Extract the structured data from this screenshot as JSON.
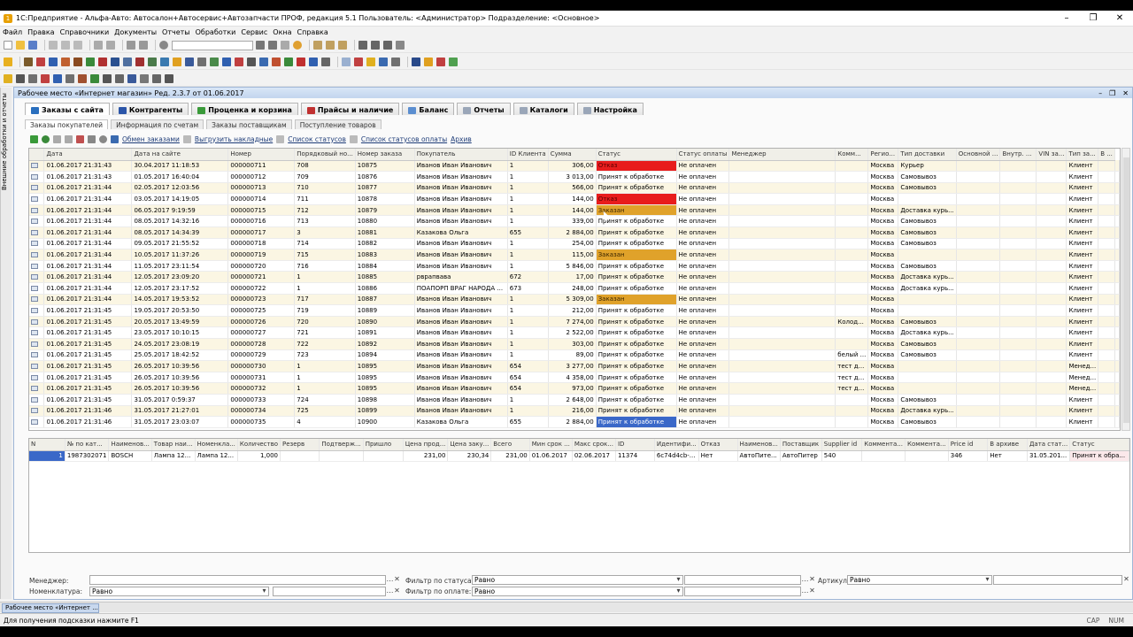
{
  "window": {
    "title": "1С:Предприятие - Альфа-Авто: Автосалон+Автосервис+Автозапчасти ПРОФ, редакция 5.1    Пользователь: <Администратор>    Подразделение: <Основное>"
  },
  "menu": [
    "Файл",
    "Правка",
    "Справочники",
    "Документы",
    "Отчеты",
    "Обработки",
    "Сервис",
    "Окна",
    "Справка"
  ],
  "leftpanel": {
    "label": "Внешние обработки и отчеты"
  },
  "workspace": {
    "title": "Рабочее место «Интернет магазин» Ред. 2.3.7 от 01.06.2017"
  },
  "main_tabs": [
    {
      "label": "Заказы с сайта",
      "color": "#2a6fbe"
    },
    {
      "label": "Контрагенты",
      "color": "#2b55a8"
    },
    {
      "label": "Проценка и корзина",
      "color": "#3a9a3a"
    },
    {
      "label": "Прайсы и наличие",
      "color": "#c03030"
    },
    {
      "label": "Баланс",
      "color": "#5b8ed0"
    },
    {
      "label": "Отчеты",
      "color": "#9aa6b8"
    },
    {
      "label": "Каталоги",
      "color": "#9aa6b8"
    },
    {
      "label": "Настройка",
      "color": "#9aa6b8"
    }
  ],
  "sub_tabs": [
    "Заказы покупателей",
    "Информация по счетам",
    "Заказы поставщикам",
    "Поступление товаров"
  ],
  "actions": {
    "exchange": "Обмен заказами",
    "export": "Выгрузить накладные",
    "status_list": "Список статусов",
    "pay_status_list": "Список статусов оплаты",
    "archive": "Архив"
  },
  "grid": {
    "columns": [
      "Дата",
      "Дата на сайте",
      "Номер",
      "Порядковый но...",
      "Номер заказа",
      "Покупатель",
      "ID Клиента",
      "Сумма",
      "Статус",
      "Статус оплаты",
      "Менеджер",
      "Комм...",
      "Регио...",
      "Тип доставки",
      "Основной ...",
      "Внутр. ...",
      "VIN за...",
      "Тип за...",
      "В ..."
    ],
    "rows": [
      [
        "01.06.2017 21:31:43",
        "30.04.2017 11:18:53",
        "000000711",
        "708",
        "10875",
        "Иванов Иван Иванович",
        "1",
        "306,00",
        "Отказ",
        "Не оплачен",
        "",
        "",
        "Москва",
        "Курьер",
        "",
        "",
        "",
        "Клиент",
        ""
      ],
      [
        "01.06.2017 21:31:43",
        "01.05.2017 16:40:04",
        "000000712",
        "709",
        "10876",
        "Иванов Иван Иванович",
        "1",
        "3 013,00",
        "Принят к обработке",
        "Не оплачен",
        "",
        "",
        "Москва",
        "Самовывоз",
        "",
        "",
        "",
        "Клиент",
        ""
      ],
      [
        "01.06.2017 21:31:44",
        "02.05.2017 12:03:56",
        "000000713",
        "710",
        "10877",
        "Иванов Иван Иванович",
        "1",
        "566,00",
        "Принят к обработке",
        "Не оплачен",
        "",
        "",
        "Москва",
        "Самовывоз",
        "",
        "",
        "",
        "Клиент",
        ""
      ],
      [
        "01.06.2017 21:31:44",
        "03.05.2017 14:19:05",
        "000000714",
        "711",
        "10878",
        "Иванов Иван Иванович",
        "1",
        "144,00",
        "Отказ",
        "Не оплачен",
        "",
        "",
        "Москва",
        "",
        "",
        "",
        "",
        "Клиент",
        ""
      ],
      [
        "01.06.2017 21:31:44",
        "06.05.2017 9:19:59",
        "000000715",
        "712",
        "10879",
        "Иванов Иван Иванович",
        "1",
        "144,00",
        "Заказан",
        "Не оплачен",
        "",
        "",
        "Москва",
        "Доставка курь...",
        "",
        "",
        "",
        "Клиент",
        ""
      ],
      [
        "01.06.2017 21:31:44",
        "08.05.2017 14:32:16",
        "000000716",
        "713",
        "10880",
        "Иванов Иван Иванович",
        "1",
        "339,00",
        "Принят к обработке",
        "Не оплачен",
        "",
        "",
        "Москва",
        "Самовывоз",
        "",
        "",
        "",
        "Клиент",
        ""
      ],
      [
        "01.06.2017 21:31:44",
        "08.05.2017 14:34:39",
        "000000717",
        "3",
        "10881",
        "Казакова Ольга",
        "655",
        "2 884,00",
        "Принят к обработке",
        "Не оплачен",
        "",
        "",
        "Москва",
        "Самовывоз",
        "",
        "",
        "",
        "Клиент",
        ""
      ],
      [
        "01.06.2017 21:31:44",
        "09.05.2017 21:55:52",
        "000000718",
        "714",
        "10882",
        "Иванов Иван Иванович",
        "1",
        "254,00",
        "Принят к обработке",
        "Не оплачен",
        "",
        "",
        "Москва",
        "Самовывоз",
        "",
        "",
        "",
        "Клиент",
        ""
      ],
      [
        "01.06.2017 21:31:44",
        "10.05.2017 11:37:26",
        "000000719",
        "715",
        "10883",
        "Иванов Иван Иванович",
        "1",
        "115,00",
        "Заказан",
        "Не оплачен",
        "",
        "",
        "Москва",
        "",
        "",
        "",
        "",
        "Клиент",
        ""
      ],
      [
        "01.06.2017 21:31:44",
        "11.05.2017 23:11:54",
        "000000720",
        "716",
        "10884",
        "Иванов Иван Иванович",
        "1",
        "5 846,00",
        "Принят к обработке",
        "Не оплачен",
        "",
        "",
        "Москва",
        "Самовывоз",
        "",
        "",
        "",
        "Клиент",
        ""
      ],
      [
        "01.06.2017 21:31:44",
        "12.05.2017 23:09:20",
        "000000721",
        "1",
        "10885",
        "рврапвава",
        "672",
        "17,00",
        "Принят к обработке",
        "Не оплачен",
        "",
        "",
        "Москва",
        "Доставка курь...",
        "",
        "",
        "",
        "Клиент",
        ""
      ],
      [
        "01.06.2017 21:31:44",
        "12.05.2017 23:17:52",
        "000000722",
        "1",
        "10886",
        "ПОАПОРП ВРАГ НАРОДА ...",
        "673",
        "248,00",
        "Принят к обработке",
        "Не оплачен",
        "",
        "",
        "Москва",
        "Доставка курь...",
        "",
        "",
        "",
        "Клиент",
        ""
      ],
      [
        "01.06.2017 21:31:44",
        "14.05.2017 19:53:52",
        "000000723",
        "717",
        "10887",
        "Иванов Иван Иванович",
        "1",
        "5 309,00",
        "Заказан",
        "Не оплачен",
        "",
        "",
        "Москва",
        "",
        "",
        "",
        "",
        "Клиент",
        ""
      ],
      [
        "01.06.2017 21:31:45",
        "19.05.2017 20:53:50",
        "000000725",
        "719",
        "10889",
        "Иванов Иван Иванович",
        "1",
        "212,00",
        "Принят к обработке",
        "Не оплачен",
        "",
        "",
        "Москва",
        "",
        "",
        "",
        "",
        "Клиент",
        ""
      ],
      [
        "01.06.2017 21:31:45",
        "20.05.2017 13:49:59",
        "000000726",
        "720",
        "10890",
        "Иванов Иван Иванович",
        "1",
        "7 274,00",
        "Принят к обработке",
        "Не оплачен",
        "",
        "Колод...",
        "Москва",
        "Самовывоз",
        "",
        "",
        "",
        "Клиент",
        ""
      ],
      [
        "01.06.2017 21:31:45",
        "23.05.2017 10:10:15",
        "000000727",
        "721",
        "10891",
        "Иванов Иван Иванович",
        "1",
        "2 522,00",
        "Принят к обработке",
        "Не оплачен",
        "",
        "",
        "Москва",
        "Доставка курь...",
        "",
        "",
        "",
        "Клиент",
        ""
      ],
      [
        "01.06.2017 21:31:45",
        "24.05.2017 23:08:19",
        "000000728",
        "722",
        "10892",
        "Иванов Иван Иванович",
        "1",
        "303,00",
        "Принят к обработке",
        "Не оплачен",
        "",
        "",
        "Москва",
        "Самовывоз",
        "",
        "",
        "",
        "Клиент",
        ""
      ],
      [
        "01.06.2017 21:31:45",
        "25.05.2017 18:42:52",
        "000000729",
        "723",
        "10894",
        "Иванов Иван Иванович",
        "1",
        "89,00",
        "Принят к обработке",
        "Не оплачен",
        "",
        "белый ...",
        "Москва",
        "Самовывоз",
        "",
        "",
        "",
        "Клиент",
        ""
      ],
      [
        "01.06.2017 21:31:45",
        "26.05.2017 10:39:56",
        "000000730",
        "1",
        "10895",
        "Иванов Иван Иванович",
        "654",
        "3 277,00",
        "Принят к обработке",
        "Не оплачен",
        "",
        "тест д...",
        "Москва",
        "",
        "",
        "",
        "",
        "Менед...",
        ""
      ],
      [
        "01.06.2017 21:31:45",
        "26.05.2017 10:39:56",
        "000000731",
        "1",
        "10895",
        "Иванов Иван Иванович",
        "654",
        "4 358,00",
        "Принят к обработке",
        "Не оплачен",
        "",
        "тест д...",
        "Москва",
        "",
        "",
        "",
        "",
        "Менед...",
        ""
      ],
      [
        "01.06.2017 21:31:45",
        "26.05.2017 10:39:56",
        "000000732",
        "1",
        "10895",
        "Иванов Иван Иванович",
        "654",
        "973,00",
        "Принят к обработке",
        "Не оплачен",
        "",
        "тест д...",
        "Москва",
        "",
        "",
        "",
        "",
        "Менед...",
        ""
      ],
      [
        "01.06.2017 21:31:45",
        "31.05.2017 0:59:37",
        "000000733",
        "724",
        "10898",
        "Иванов Иван Иванович",
        "1",
        "2 648,00",
        "Принят к обработке",
        "Не оплачен",
        "",
        "",
        "Москва",
        "Самовывоз",
        "",
        "",
        "",
        "Клиент",
        ""
      ],
      [
        "01.06.2017 21:31:46",
        "31.05.2017 21:27:01",
        "000000734",
        "725",
        "10899",
        "Иванов Иван Иванович",
        "1",
        "216,00",
        "Принят к обработке",
        "Не оплачен",
        "",
        "",
        "Москва",
        "Доставка курь...",
        "",
        "",
        "",
        "Клиент",
        ""
      ],
      [
        "01.06.2017 21:31:46",
        "31.05.2017 23:03:07",
        "000000735",
        "4",
        "10900",
        "Казакова Ольга",
        "655",
        "2 884,00",
        "Принят к обработке",
        "Не оплачен",
        "",
        "",
        "Москва",
        "Самовывоз",
        "",
        "",
        "",
        "Клиент",
        ""
      ]
    ]
  },
  "grid2": {
    "columns": [
      "N",
      "№ по кат...",
      "Наименов...",
      "Товар наи...",
      "Номенкла...",
      "Количество",
      "Резерв",
      "Подтверж...",
      "Пришло",
      "Цена прод...",
      "Цена заку...",
      "Всего",
      "Мин срок ...",
      "Макс срок...",
      "ID",
      "Идентифи...",
      "Отказ",
      "Наименов...",
      "Поставщик",
      "Supplier id",
      "Коммента...",
      "Коммента...",
      "Price id",
      "В архиве",
      "Дата стат...",
      "Статус"
    ],
    "rows": [
      [
        "1",
        "1987302071",
        "BOSCH",
        "Лампа 12...",
        "Лампа 12...",
        "1,000",
        "",
        "",
        "",
        "231,00",
        "230,34",
        "231,00",
        "01.06.2017",
        "02.06.2017",
        "11374",
        "6c74d4cb-...",
        "Нет",
        "АвтоПите...",
        "АвтоПитер",
        "540",
        "",
        "",
        "346",
        "Нет",
        "31.05.201...",
        "Принят к обра..."
      ]
    ]
  },
  "filters": {
    "manager_label": "Менеджер:",
    "manager_value": "",
    "nomen_label": "Номенклатура:",
    "nomen_value": "Равно",
    "status_label": "Фильтр по статусам:",
    "status_value": "Равно",
    "pay_label": "Фильтр по оплате:",
    "pay_value": "Равно",
    "article_label": "Артикул:",
    "article_value": "Равно"
  },
  "taskbar": {
    "item": "Рабочее место «Интернет ..."
  },
  "status": {
    "hint": "Для получения подсказки нажмите F1",
    "cap": "CAP",
    "num": "NUM"
  }
}
